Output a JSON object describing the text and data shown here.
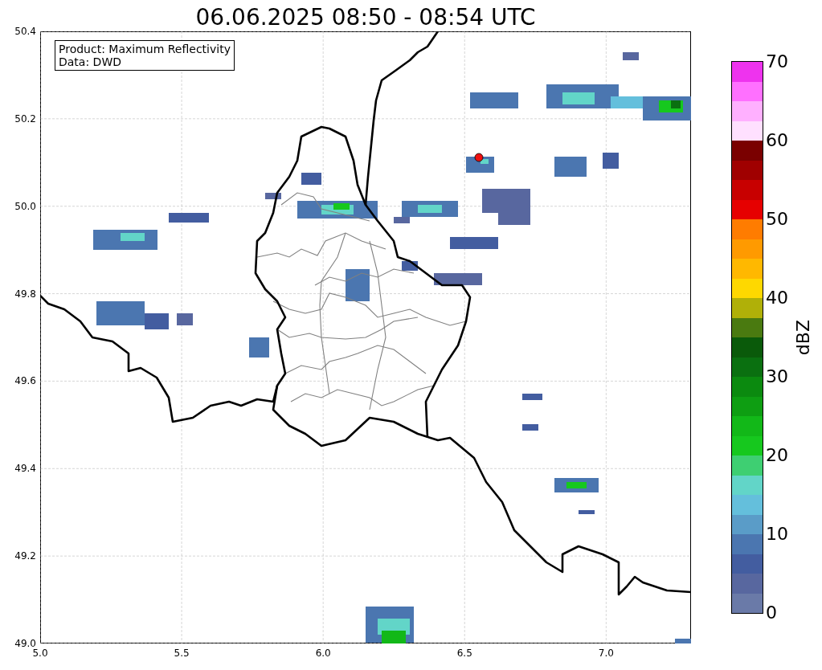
{
  "title": "06.06.2025 08:50 - 08:54 UTC",
  "info_box": {
    "lines": [
      "Product: Maximum Reflectivity",
      "Data: DWD"
    ]
  },
  "map": {
    "xticks": [
      "5.0",
      "5.5",
      "6.0",
      "6.5",
      "7.0"
    ],
    "yticks": [
      "50.4",
      "50.2",
      "50.0",
      "49.8",
      "49.6",
      "49.4",
      "49.2",
      "49.0"
    ]
  },
  "colorbar": {
    "label": "dBZ",
    "ticks": [
      "70",
      "60",
      "50",
      "40",
      "30",
      "20",
      "10",
      "0"
    ],
    "bands": [
      {
        "color": "#6a7aa8"
      },
      {
        "color": "#58679f"
      },
      {
        "color": "#435da0"
      },
      {
        "color": "#4b76b0"
      },
      {
        "color": "#5a9cc8"
      },
      {
        "color": "#64bfdc"
      },
      {
        "color": "#62d5c8"
      },
      {
        "color": "#3ecf72"
      },
      {
        "color": "#16c81e"
      },
      {
        "color": "#12b818"
      },
      {
        "color": "#0e9e12"
      },
      {
        "color": "#0b8a0f"
      },
      {
        "color": "#0a7010"
      },
      {
        "color": "#0a5a0a"
      },
      {
        "color": "#4a7a10"
      },
      {
        "color": "#b0b008"
      },
      {
        "color": "#fed800"
      },
      {
        "color": "#ffb800"
      },
      {
        "color": "#ff9a00"
      },
      {
        "color": "#ff7c00"
      },
      {
        "color": "#e60000"
      },
      {
        "color": "#c80000"
      },
      {
        "color": "#a00000"
      },
      {
        "color": "#7a0000"
      },
      {
        "color": "#ffe0ff"
      },
      {
        "color": "#ffb0ff"
      },
      {
        "color": "#ff70ff"
      },
      {
        "color": "#ee33ee"
      }
    ]
  }
}
